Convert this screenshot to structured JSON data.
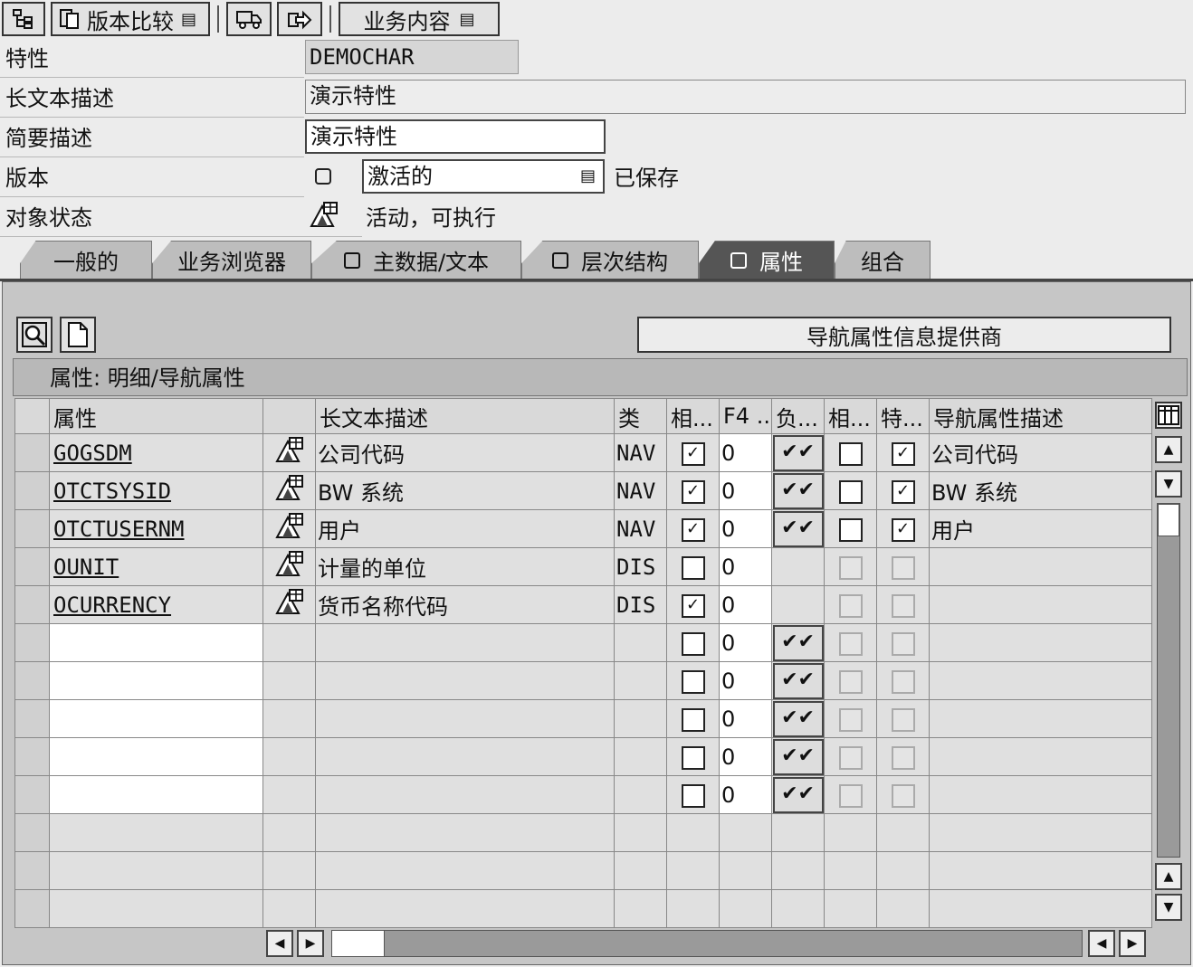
{
  "toolbar": {
    "version_compare_label": "版本比较",
    "business_content_label": "业务内容"
  },
  "fields": {
    "characteristic": {
      "label": "特性",
      "value": "DEMOCHAR"
    },
    "long_text": {
      "label": "长文本描述",
      "value": "演示特性"
    },
    "short_text": {
      "label": "简要描述",
      "value": "演示特性"
    },
    "version": {
      "label": "版本",
      "value": "激活的",
      "status": "已保存"
    },
    "object_status": {
      "label": "对象状态",
      "value": "活动，可执行"
    }
  },
  "tabs": [
    {
      "label": "一般的"
    },
    {
      "label": "业务浏览器"
    },
    {
      "label": "主数据/文本"
    },
    {
      "label": "层次结构"
    },
    {
      "label": "属性"
    },
    {
      "label": "组合"
    }
  ],
  "nav_provider_button": "导航属性信息提供商",
  "panel_title": "属性: 明细/导航属性",
  "columns": [
    "属性",
    "",
    "长文本描述",
    "类",
    "相...",
    "F4 ...",
    "负...",
    "相...",
    "特...",
    "导航属性描述"
  ],
  "rows": [
    {
      "attr": "GOGSDM",
      "desc": "公司代码",
      "type": "NAV",
      "c1": true,
      "f4": "0",
      "nav": true,
      "c2": false,
      "c3": true,
      "navdesc": "公司代码",
      "enabled": true
    },
    {
      "attr": "OTCTSYSID",
      "desc": "BW 系统",
      "type": "NAV",
      "c1": true,
      "f4": "0",
      "nav": true,
      "c2": false,
      "c3": true,
      "navdesc": "BW 系统",
      "enabled": true
    },
    {
      "attr": "OTCTUSERNM",
      "desc": "用户",
      "type": "NAV",
      "c1": true,
      "f4": "0",
      "nav": true,
      "c2": false,
      "c3": true,
      "navdesc": "用户",
      "enabled": true
    },
    {
      "attr": "OUNIT",
      "desc": "计量的单位",
      "type": "DIS",
      "c1": false,
      "f4": "0",
      "nav": false,
      "c2": false,
      "c3": false,
      "navdesc": "",
      "enabled": false
    },
    {
      "attr": "OCURRENCY",
      "desc": "货币名称代码",
      "type": "DIS",
      "c1": true,
      "f4": "0",
      "nav": false,
      "c2": false,
      "c3": false,
      "navdesc": "",
      "enabled": false
    }
  ],
  "empty_rows_f4": "0"
}
